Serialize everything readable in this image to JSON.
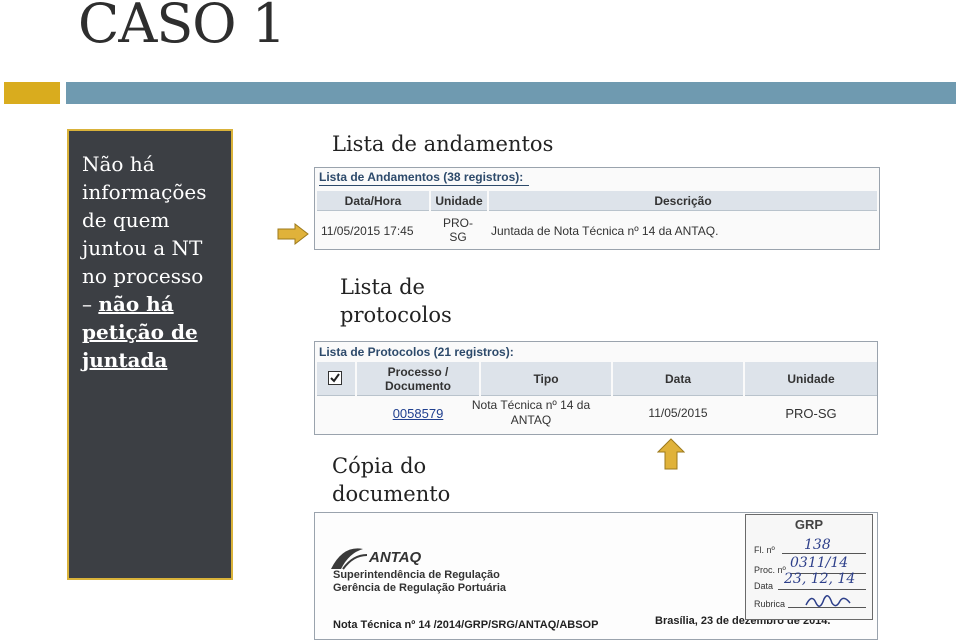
{
  "slide": {
    "title": "CASO 1",
    "side_text_lines": [
      "Não há",
      "informações",
      "de quem",
      "juntou a NT",
      "no processo"
    ],
    "side_dash": "– ",
    "side_bold_lines": [
      "não há",
      "petição de",
      "juntada"
    ],
    "colors": {
      "gold": "#d9ac1e",
      "blue": "#6f9ab0",
      "panel": "#3c3f44"
    }
  },
  "andamentos": {
    "caption": "Lista de andamentos",
    "header": "Lista de Andamentos (38 registros):",
    "columns": [
      "Data/Hora",
      "Unidade",
      "Descrição"
    ],
    "row": {
      "datahora": "11/05/2015 17:45",
      "unidade_l1": "PRO-",
      "unidade_l2": "SG",
      "descricao": "Juntada de Nota Técnica nº 14 da ANTAQ."
    }
  },
  "protocolos": {
    "caption_l1": "Lista de",
    "caption_l2": "protocolos",
    "header": "Lista de Protocolos (21 registros):",
    "columns": {
      "processo_l1": "Processo /",
      "processo_l2": "Documento",
      "tipo": "Tipo",
      "data": "Data",
      "unidade": "Unidade"
    },
    "row": {
      "numero": "0058579",
      "tipo_l1": "Nota Técnica nº 14 da",
      "tipo_l2": "ANTAQ",
      "data": "11/05/2015",
      "unidade": "PRO-SG"
    }
  },
  "documento": {
    "caption_l1": "Cópia do",
    "caption_l2": "documento",
    "logo": "ANTAQ",
    "org_l1": "Superintendência de Regulação",
    "org_l2": "Gerência de Regulação Portuária",
    "nota": "Nota Técnica nº 14 /2014/GRP/SRG/ANTAQ/ABSOP",
    "local_data": "Brasília, 23 de dezembro de 2014.",
    "stamp": {
      "title": "GRP",
      "fl_label": "Fl. nº",
      "fl_value": "138",
      "proc_label": "Proc. nº",
      "proc_value": "0311/14",
      "data_label": "Data",
      "data_value": "23, 12, 14",
      "rubrica_label": "Rubrica"
    }
  }
}
